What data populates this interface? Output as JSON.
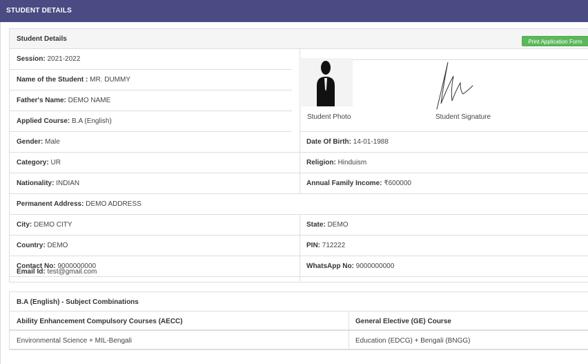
{
  "panel": {
    "title": "STUDENT DETAILS"
  },
  "details": {
    "title": "Student Details",
    "print_button": "Print Application Form",
    "session": {
      "label": "Session:",
      "value": "2021-2022"
    },
    "name": {
      "label": "Name of the Student :",
      "value": "MR. DUMMY"
    },
    "father": {
      "label": "Father's Name:",
      "value": "DEMO NAME"
    },
    "course": {
      "label": "Applied Course:",
      "value": "B.A (English)"
    },
    "photo_caption": "Student Photo",
    "signature_caption": "Student Signature",
    "gender": {
      "label": "Gender:",
      "value": "Male"
    },
    "dob": {
      "label": "Date Of Birth:",
      "value": "14-01-1988"
    },
    "category": {
      "label": "Category:",
      "value": "UR"
    },
    "religion": {
      "label": "Religion:",
      "value": "Hinduism"
    },
    "nationality": {
      "label": "Nationality:",
      "value": "INDIAN"
    },
    "income": {
      "label": "Annual Family Income:",
      "value": "₹600000"
    },
    "address": {
      "label": "Permanent Address:",
      "value": "DEMO ADDRESS"
    },
    "city": {
      "label": "City:",
      "value": "DEMO CITY"
    },
    "state": {
      "label": "State:",
      "value": "DEMO"
    },
    "country": {
      "label": "Country:",
      "value": "DEMO"
    },
    "pin": {
      "label": "PIN:",
      "value": "712222"
    },
    "contact": {
      "label": "Contact No:",
      "value": "9000000000"
    },
    "whatsapp": {
      "label": "WhatsApp No:",
      "value": "9000000000"
    },
    "email": {
      "label": "Email Id:",
      "value": "test@gmail.com"
    }
  },
  "subjects": {
    "title": "B.A (English) - Subject Combinations",
    "col1_header": "Ability Enhancement Compulsory Courses (AECC)",
    "col2_header": "General Elective (GE) Course",
    "col1_value": "Environmental Science + MIL-Bengali",
    "col2_value": "Education (EDCG) + Bengali (BNGG)"
  },
  "icons": {
    "photo": "person-silhouette-icon",
    "signature": "signature-image"
  }
}
